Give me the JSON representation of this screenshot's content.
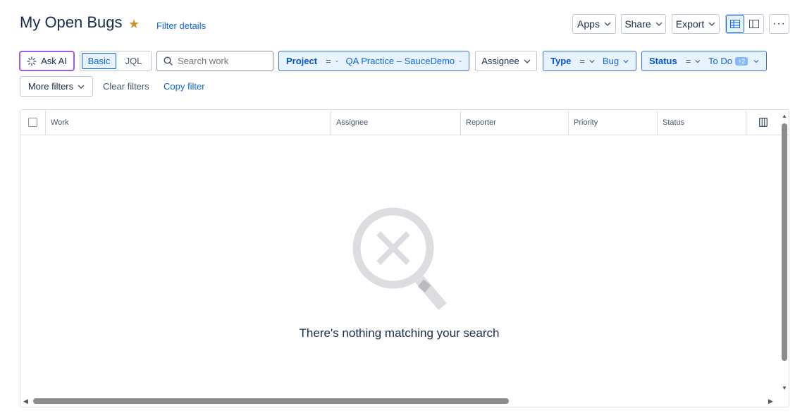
{
  "header": {
    "title": "My Open Bugs",
    "filter_details": "Filter details",
    "apps": "Apps",
    "share": "Share",
    "export": "Export"
  },
  "toolbar": {
    "ask_ai": "Ask AI",
    "basic": "Basic",
    "jql": "JQL",
    "search_placeholder": "Search work",
    "assignee": "Assignee",
    "more_filters": "More filters",
    "clear_filters": "Clear filters",
    "copy_filter": "Copy filter"
  },
  "filters": {
    "project": {
      "name": "Project",
      "op": "=",
      "value": "QA Practice – SauceDemo"
    },
    "type": {
      "name": "Type",
      "op": "=",
      "value": "Bug"
    },
    "status": {
      "name": "Status",
      "op": "=",
      "value": "To Do",
      "badge": "+2"
    }
  },
  "table": {
    "columns": [
      "Work",
      "Assignee",
      "Reporter",
      "Priority",
      "Status"
    ]
  },
  "empty_state": {
    "message": "There's nothing matching your search"
  },
  "colors": {
    "accent": "#0c66e4",
    "ai_border": "#a259e6",
    "star": "#c9962b"
  }
}
